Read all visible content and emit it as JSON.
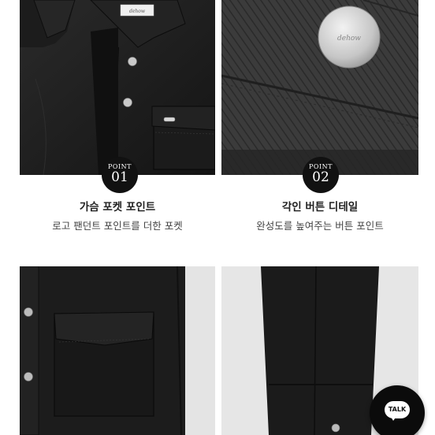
{
  "details": [
    {
      "badge_point": "POINT",
      "badge_number": "01",
      "title": "가슴 포켓 포인트",
      "description": "로고 팬던트 포인트를 더한 포켓"
    },
    {
      "badge_point": "POINT",
      "badge_number": "02",
      "title": "각인 버튼 디테일",
      "description": "완성도를 높여주는 버튼 포인트"
    }
  ],
  "logo_text": "dehow",
  "talk_button": {
    "label": "TALK"
  },
  "colors": {
    "badge": "#111111",
    "denim_dark": "#1a1a1a",
    "background": "#ffffff"
  }
}
